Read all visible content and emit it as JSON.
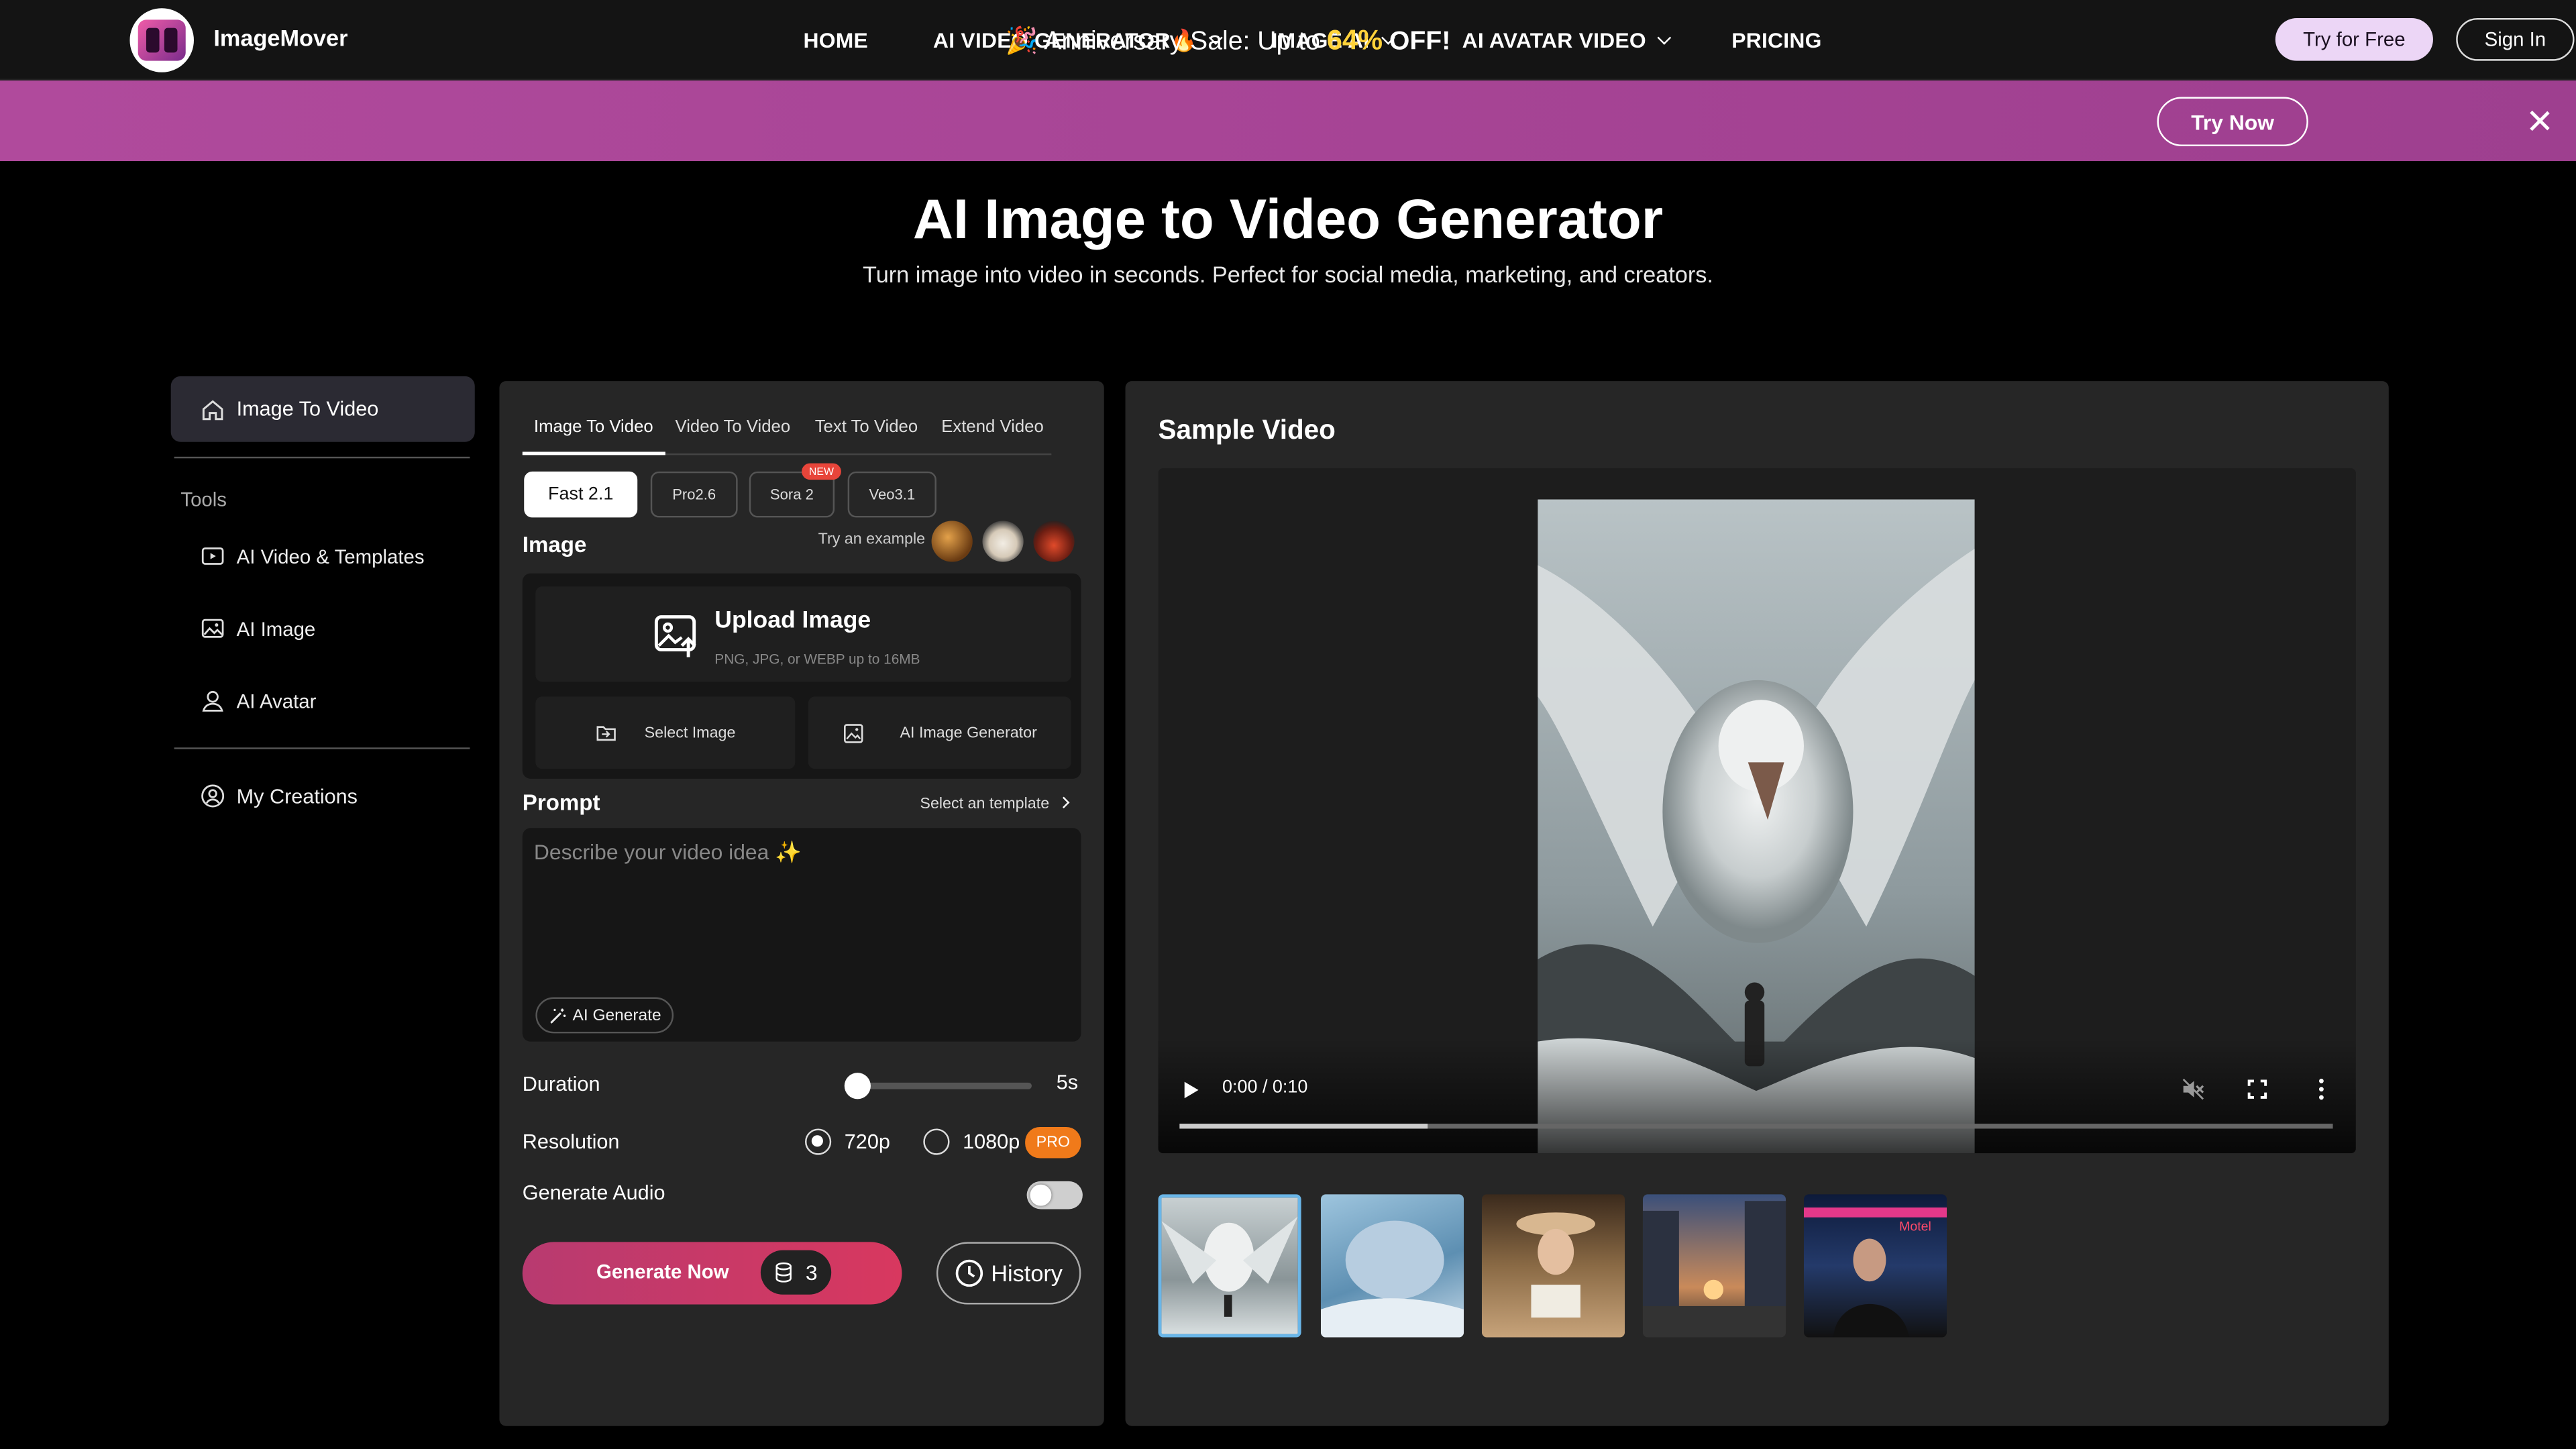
{
  "brand": {
    "name": "ImageMover"
  },
  "nav": {
    "items": [
      {
        "label": "HOME",
        "has_dropdown": false
      },
      {
        "label": "AI VIDEO GENERATOR🔥",
        "has_dropdown": true
      },
      {
        "label": "IMAGE AI",
        "has_dropdown": true
      },
      {
        "label": "AI AVATAR VIDEO",
        "has_dropdown": true
      },
      {
        "label": "PRICING",
        "has_dropdown": false
      }
    ],
    "try_free": "Try for Free",
    "sign_in": "Sign In"
  },
  "promo": {
    "prefix": "🎉 Anniversary Sale: Up to",
    "percent": "64%",
    "suffix": "OFF!",
    "cta": "Try Now",
    "background": "#a8468f"
  },
  "hero": {
    "title": "AI Image to Video Generator",
    "subtitle": "Turn image into video in seconds. Perfect for social media, marketing, and creators."
  },
  "sidebar": {
    "active": "Image To Video",
    "tools_label": "Tools",
    "items": [
      {
        "label": "AI Video & Templates",
        "icon": "video-template-icon"
      },
      {
        "label": "AI Image",
        "icon": "image-icon"
      },
      {
        "label": "AI Avatar",
        "icon": "user-icon"
      }
    ],
    "creations": "My Creations"
  },
  "generator": {
    "tabs": [
      "Image To Video",
      "Video To Video",
      "Text To Video",
      "Extend Video"
    ],
    "active_tab": "Image To Video",
    "models": [
      "Fast 2.1",
      "Pro2.6",
      "Sora 2",
      "Veo3.1"
    ],
    "active_model": "Fast 2.1",
    "new_badge": "NEW",
    "image_heading": "Image",
    "try_example": "Try an example",
    "upload": {
      "title": "Upload Image",
      "subtitle": "PNG, JPG, or WEBP up to 16MB",
      "select_image": "Select Image",
      "ai_image_generator": "AI Image Generator"
    },
    "prompt_heading": "Prompt",
    "select_template": "Select an template",
    "prompt_placeholder": "Describe your video idea ✨",
    "ai_generate": "AI Generate",
    "duration_label": "Duration",
    "duration_value": "5s",
    "duration_slider_fraction": 0.0,
    "resolution_label": "Resolution",
    "resolutions": [
      "720p",
      "1080p"
    ],
    "selected_resolution": "720p",
    "pro_badge": "PRO",
    "audio_label": "Generate Audio",
    "audio_enabled": false,
    "generate_button": "Generate Now",
    "credits": "3",
    "history_button": "History",
    "accent": "#cf3a66"
  },
  "preview": {
    "title": "Sample Video",
    "time": "0:00 / 0:10",
    "progress_fraction": 0.215,
    "thumbnails": [
      "giant eagle",
      "frozen creature",
      "cowgirl with letter",
      "city sunset street",
      "man on phone at night"
    ],
    "selected_thumbnail": 0
  }
}
